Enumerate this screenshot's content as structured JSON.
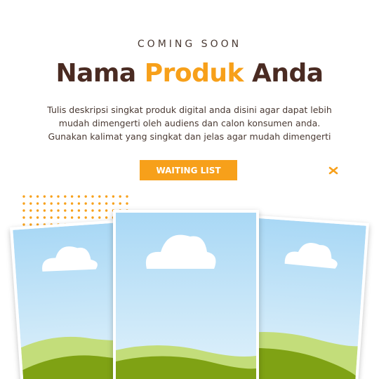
{
  "header": {
    "eyebrow": "COMING SOON",
    "title_part1": "Nama",
    "title_accent": "Produk",
    "title_part2": "Anda"
  },
  "description": {
    "line1": "Tulis deskripsi singkat produk digital anda disini agar dapat lebih",
    "line2": "mudah dimengerti oleh audiens dan calon konsumen anda.",
    "line3": "Gunakan kalimat yang singkat dan jelas agar mudah dimengerti"
  },
  "cta": {
    "label": "WAITING LIST"
  },
  "colors": {
    "accent": "#f7a01a",
    "title_dark": "#4a2b22",
    "sky_top": "#a9d8f5",
    "sky_bottom": "#e4f3fb",
    "hill_light": "#c3dd7a",
    "hill_dark": "#7fa214"
  },
  "icons": {
    "sparkle": "sparkle-icon",
    "dot_grid": "dot-pattern",
    "cloud": "cloud-icon"
  }
}
